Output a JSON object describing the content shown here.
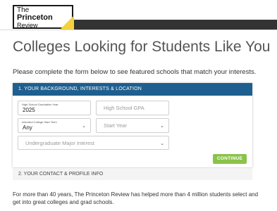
{
  "logo": {
    "line1": "The",
    "line2": "Princeton",
    "line3": "Review"
  },
  "page": {
    "title": "Colleges Looking for Students Like You",
    "intro": "Please complete the form below to see featured schools that match your interests."
  },
  "form": {
    "section1_title": "1. YOUR BACKGROUND, INTERESTS & LOCATION",
    "grad_year": {
      "label": "High School Graduation Year",
      "value": "2025"
    },
    "gpa": {
      "placeholder": "High School GPA"
    },
    "start_term": {
      "label": "Intended College Start Term",
      "value": "Any"
    },
    "start_year": {
      "placeholder": "Start Year"
    },
    "major": {
      "placeholder": "Undergraduate Major Interest"
    },
    "continue_label": "CONTINUE",
    "section2_title": "2. YOUR CONTACT & PROFILE INFO"
  },
  "footer": {
    "text": "For more than 40 years, The Princeton Review has helped more than 4 million students select and get into great colleges and grad schools."
  },
  "colors": {
    "header_blue": "#1e5f8f",
    "continue_green": "#8bc34a",
    "logo_yellow": "#f3d23c",
    "topbar_dark": "#333333"
  }
}
